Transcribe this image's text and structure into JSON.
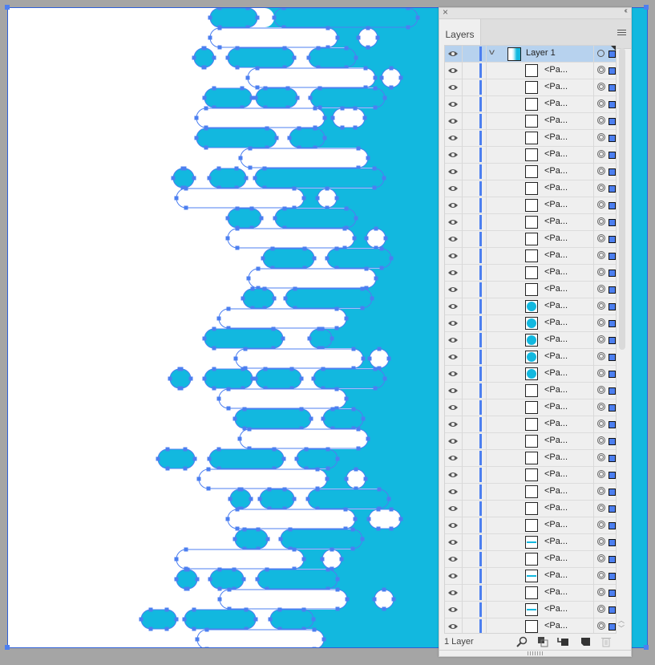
{
  "colors": {
    "canvas_bg": "#a5a5a5",
    "artwork_blue": "#12b8df",
    "artwork_white": "#ffffff",
    "selection_blue": "#4c7ff0",
    "layer_selected_bg": "#b7d2ee"
  },
  "artwork": {
    "rows": [
      {
        "kind": "blue",
        "end": 341,
        "pills": [
          [
            261,
            320
          ],
          [
            341,
            520
          ]
        ],
        "circles": []
      },
      {
        "kind": "white",
        "end": 420,
        "pills": [
          [
            261,
            420
          ]
        ],
        "circles": [
          458
        ]
      },
      {
        "kind": "blue",
        "end": 443,
        "pills": [
          [
            241,
            266
          ],
          [
            283,
            366
          ],
          [
            384,
            443
          ]
        ],
        "circles": []
      },
      {
        "kind": "white",
        "end": 467,
        "pills": [
          [
            308,
            467
          ]
        ],
        "circles": [
          487
        ]
      },
      {
        "kind": "blue",
        "end": 479,
        "pills": [
          [
            254,
            313
          ],
          [
            318,
            370
          ],
          [
            386,
            479
          ]
        ],
        "circles": []
      },
      {
        "kind": "white",
        "end": 404,
        "pills": [
          [
            244,
            404
          ],
          [
            414,
            454
          ]
        ],
        "circles": []
      },
      {
        "kind": "blue",
        "end": 404,
        "pills": [
          [
            244,
            344
          ],
          [
            360,
            404
          ]
        ],
        "circles": []
      },
      {
        "kind": "white",
        "end": 458,
        "pills": [
          [
            299,
            458
          ]
        ],
        "circles": []
      },
      {
        "kind": "blue",
        "end": 478,
        "pills": [
          [
            215,
            241
          ],
          [
            260,
            306
          ],
          [
            317,
            478
          ]
        ],
        "circles": []
      },
      {
        "kind": "white",
        "end": 378,
        "pills": [
          [
            219,
            378
          ]
        ],
        "circles": [
          407
        ]
      },
      {
        "kind": "blue",
        "end": 443,
        "pills": [
          [
            283,
            325
          ],
          [
            342,
            443
          ]
        ],
        "circles": []
      },
      {
        "kind": "white",
        "end": 441,
        "pills": [
          [
            283,
            441
          ]
        ],
        "circles": [
          468
        ]
      },
      {
        "kind": "blue",
        "end": 487,
        "pills": [
          [
            327,
            391
          ],
          [
            407,
            487
          ]
        ],
        "circles": []
      },
      {
        "kind": "white",
        "end": 468,
        "pills": [
          [
            309,
            468
          ]
        ],
        "circles": []
      },
      {
        "kind": "blue",
        "end": 463,
        "pills": [
          [
            302,
            341
          ],
          [
            355,
            463
          ]
        ],
        "circles": []
      },
      {
        "kind": "white",
        "end": 431,
        "pills": [
          [
            272,
            431
          ]
        ],
        "circles": []
      },
      {
        "kind": "blue",
        "end": 413,
        "pills": [
          [
            254,
            352
          ],
          [
            385,
            413
          ]
        ],
        "circles": []
      },
      {
        "kind": "white",
        "end": 452,
        "pills": [
          [
            293,
            452
          ]
        ],
        "circles": [
          472
        ]
      },
      {
        "kind": "blue",
        "end": 479,
        "pills": [
          [
            211,
            237
          ],
          [
            254,
            314
          ],
          [
            318,
            375
          ],
          [
            390,
            479
          ]
        ],
        "circles": []
      },
      {
        "kind": "white",
        "end": 431,
        "pills": [
          [
            272,
            431
          ]
        ],
        "circles": []
      },
      {
        "kind": "blue",
        "end": 452,
        "pills": [
          [
            292,
            387
          ],
          [
            402,
            452
          ]
        ],
        "circles": []
      },
      {
        "kind": "white",
        "end": 458,
        "pills": [
          [
            298,
            458
          ]
        ],
        "circles": []
      },
      {
        "kind": "blue",
        "end": 420,
        "pills": [
          [
            196,
            242
          ],
          [
            260,
            353
          ],
          [
            369,
            420
          ]
        ],
        "circles": []
      },
      {
        "kind": "white",
        "end": 407,
        "pills": [
          [
            247,
            407
          ]
        ],
        "circles": [
          443
        ]
      },
      {
        "kind": "blue",
        "end": 484,
        "pills": [
          [
            286,
            312
          ],
          [
            323,
            366
          ],
          [
            383,
            484
          ]
        ],
        "circles": []
      },
      {
        "kind": "white",
        "end": 442,
        "pills": [
          [
            283,
            442
          ],
          [
            459,
            499
          ]
        ],
        "circles": []
      },
      {
        "kind": "blue",
        "end": 451,
        "pills": [
          [
            292,
            333
          ],
          [
            349,
            451
          ]
        ],
        "circles": []
      },
      {
        "kind": "white",
        "end": 378,
        "pills": [
          [
            219,
            378
          ]
        ],
        "circles": [
          413
        ]
      },
      {
        "kind": "blue",
        "end": 420,
        "pills": [
          [
            219,
            245
          ],
          [
            261,
            303
          ],
          [
            320,
            420
          ]
        ],
        "circles": []
      },
      {
        "kind": "white",
        "end": 432,
        "pills": [
          [
            273,
            432
          ]
        ],
        "circles": [
          478
        ]
      },
      {
        "kind": "blue",
        "end": 390,
        "pills": [
          [
            175,
            219
          ],
          [
            229,
            318
          ],
          [
            336,
            390
          ]
        ],
        "circles": []
      },
      {
        "kind": "white",
        "end": 403,
        "pills": [
          [
            245,
            403
          ]
        ],
        "circles": []
      }
    ]
  },
  "panel": {
    "close_icon": "×",
    "collapse_icon": "‹‹",
    "tab_label": "Layers",
    "layer": {
      "name": "Layer 1",
      "expand_icon": "v"
    },
    "items": [
      {
        "name": "<Pa...",
        "thumb": "empty"
      },
      {
        "name": "<Pa...",
        "thumb": "empty"
      },
      {
        "name": "<Pa...",
        "thumb": "empty"
      },
      {
        "name": "<Pa...",
        "thumb": "empty"
      },
      {
        "name": "<Pa...",
        "thumb": "empty"
      },
      {
        "name": "<Pa...",
        "thumb": "empty"
      },
      {
        "name": "<Pa...",
        "thumb": "empty"
      },
      {
        "name": "<Pa...",
        "thumb": "empty"
      },
      {
        "name": "<Pa...",
        "thumb": "empty"
      },
      {
        "name": "<Pa...",
        "thumb": "empty"
      },
      {
        "name": "<Pa...",
        "thumb": "empty"
      },
      {
        "name": "<Pa...",
        "thumb": "empty"
      },
      {
        "name": "<Pa...",
        "thumb": "empty"
      },
      {
        "name": "<Pa...",
        "thumb": "empty"
      },
      {
        "name": "<Pa...",
        "thumb": "circle"
      },
      {
        "name": "<Pa...",
        "thumb": "circle"
      },
      {
        "name": "<Pa...",
        "thumb": "circle"
      },
      {
        "name": "<Pa...",
        "thumb": "circle"
      },
      {
        "name": "<Pa...",
        "thumb": "circle"
      },
      {
        "name": "<Pa...",
        "thumb": "empty"
      },
      {
        "name": "<Pa...",
        "thumb": "empty"
      },
      {
        "name": "<Pa...",
        "thumb": "empty"
      },
      {
        "name": "<Pa...",
        "thumb": "empty"
      },
      {
        "name": "<Pa...",
        "thumb": "empty"
      },
      {
        "name": "<Pa...",
        "thumb": "empty"
      },
      {
        "name": "<Pa...",
        "thumb": "empty"
      },
      {
        "name": "<Pa...",
        "thumb": "empty"
      },
      {
        "name": "<Pa...",
        "thumb": "empty"
      },
      {
        "name": "<Pa...",
        "thumb": "line"
      },
      {
        "name": "<Pa...",
        "thumb": "empty"
      },
      {
        "name": "<Pa...",
        "thumb": "line"
      },
      {
        "name": "<Pa...",
        "thumb": "empty"
      },
      {
        "name": "<Pa...",
        "thumb": "line"
      },
      {
        "name": "<Pa...",
        "thumb": "empty"
      }
    ],
    "footer": {
      "count_label": "1 Layer",
      "icons": [
        "locate-object-icon",
        "make-clipping-mask-icon",
        "create-sublayer-icon",
        "create-new-layer-icon",
        "delete-icon"
      ]
    }
  }
}
